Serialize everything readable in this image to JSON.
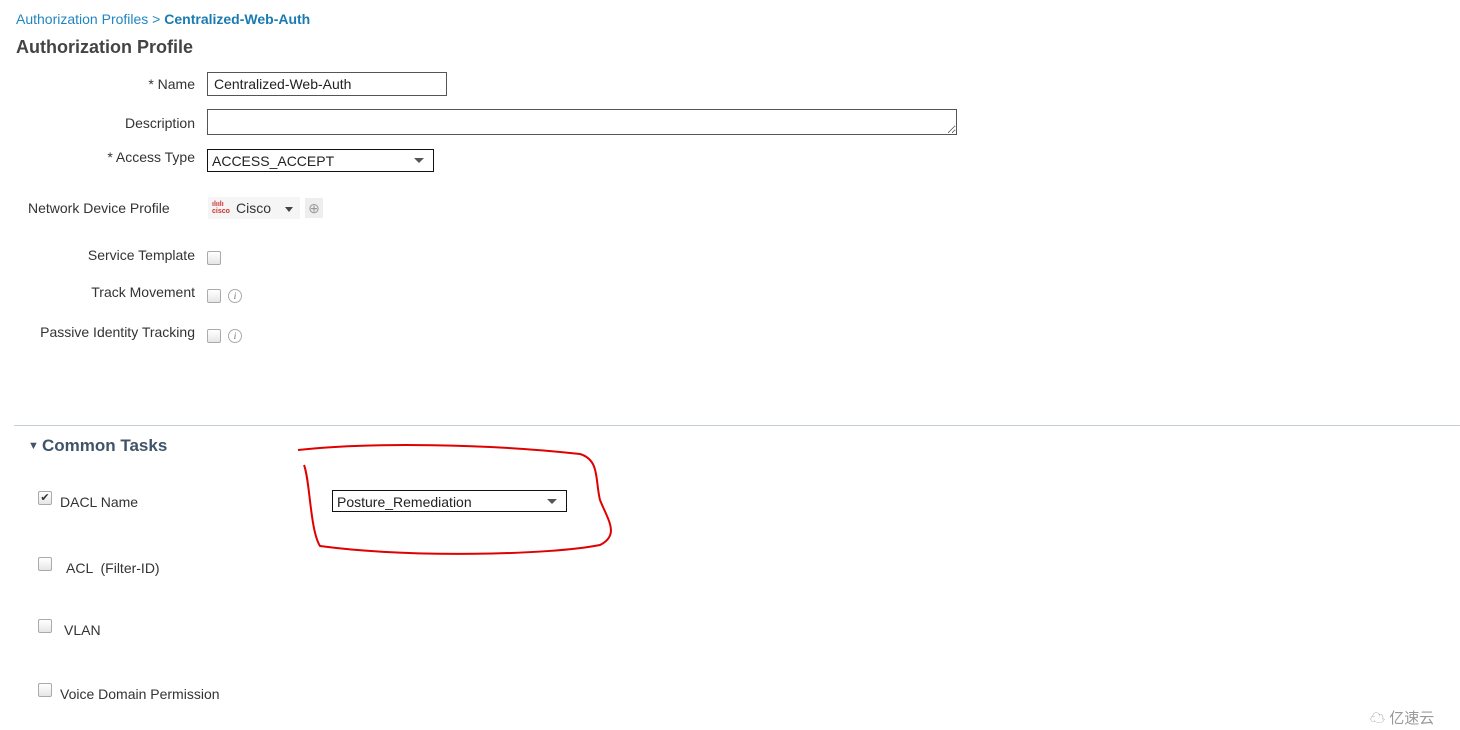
{
  "breadcrumb": {
    "parent": "Authorization Profiles",
    "separator": " > ",
    "current": "Centralized-Web-Auth"
  },
  "page_title": "Authorization Profile",
  "form": {
    "name_label": "* Name",
    "name_value": "Centralized-Web-Auth",
    "description_label": "Description",
    "description_value": "",
    "access_type_label": "* Access Type",
    "access_type_value": "ACCESS_ACCEPT",
    "ndp_label": "Network Device Profile",
    "ndp_value": "Cisco",
    "ndp_logo": "cisco",
    "service_template_label": "Service Template",
    "service_template_checked": false,
    "track_movement_label": "Track Movement",
    "track_movement_checked": false,
    "passive_identity_label": "Passive Identity Tracking",
    "passive_identity_checked": false,
    "info_glyph": "i"
  },
  "common_tasks": {
    "title": "Common Tasks",
    "items": [
      {
        "label": "DACL Name",
        "checked": true,
        "value": "Posture_Remediation"
      },
      {
        "label": "ACL  (Filter-ID)",
        "checked": false
      },
      {
        "label": "VLAN",
        "checked": false
      },
      {
        "label": "Voice Domain Permission",
        "checked": false
      }
    ]
  },
  "annotation_color": "#e00000",
  "watermark": "亿速云"
}
